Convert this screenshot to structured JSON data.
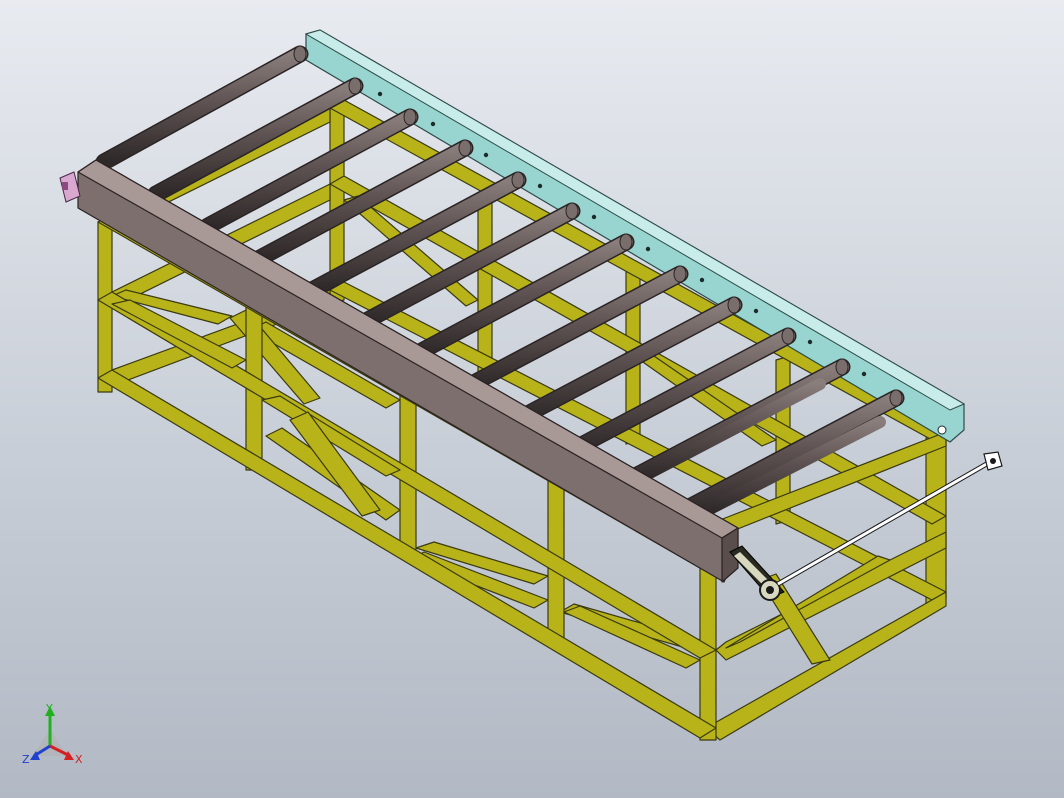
{
  "viewport": {
    "background_top": "#e8ebf0",
    "background_bottom": "#b2b9c4"
  },
  "model": {
    "frame_color": "#b8b318",
    "frame_edge_color": "#3a3a10",
    "roller_color": "#5e5352",
    "side_beam_color": "#7d6f6d",
    "back_rail_color": "#98d4d0",
    "shaft_color": "#ffffff",
    "roller_count": 12
  },
  "triad": {
    "x_label": "X",
    "y_label": "Y",
    "z_label": "Z",
    "x_color": "#d42020",
    "y_color": "#20b020",
    "z_color": "#2040d0"
  }
}
